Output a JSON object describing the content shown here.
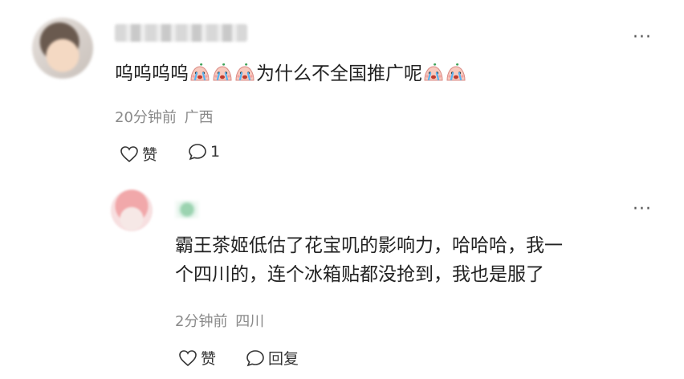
{
  "main_comment": {
    "text_before": "呜呜呜呜",
    "emojis_before_count": 3,
    "text_after": "为什么不全国推广呢",
    "emojis_after_count": 2,
    "time": "20分钟前",
    "location": "广西",
    "like_label": "赞",
    "reply_count": "1",
    "more_label": "···"
  },
  "reply": {
    "line1": "霸王茶姬低估了花宝叽的影响力，哈哈哈，我一",
    "line2": "个四川的，连个冰箱贴都没抢到，我也是服了",
    "time": "2分钟前",
    "location": "四川",
    "like_label": "赞",
    "reply_label": "回复",
    "more_label": "···"
  },
  "icons": [
    "heart-icon",
    "comment-icon",
    "crying-emoji-icon",
    "more-icon"
  ]
}
